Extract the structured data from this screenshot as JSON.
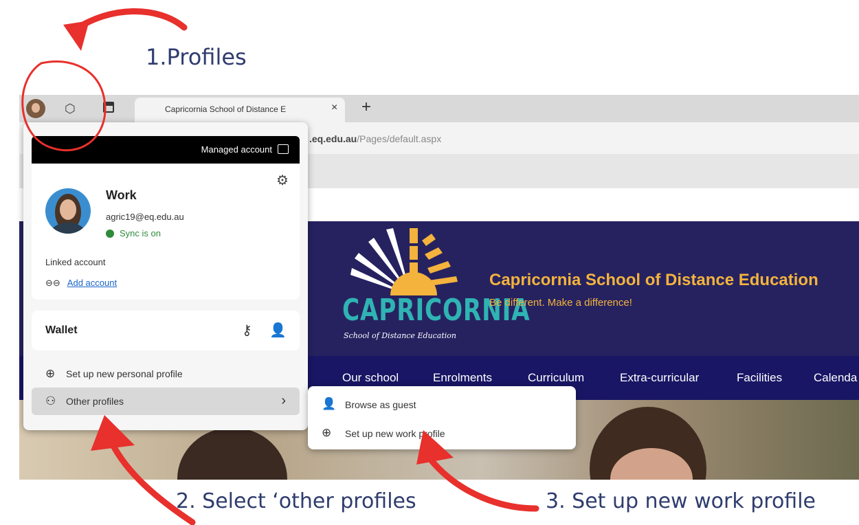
{
  "annotations": {
    "step1": "1.Profiles",
    "step2": "2. Select ‘other profiles",
    "step3": "3. Set up new work profile",
    "arrow_color": "#e8302c"
  },
  "browser": {
    "tab_title": "Capricornia School of Distance E",
    "close_glyph": "×",
    "new_tab_glyph": "+",
    "url_domain": ".eq.edu.au",
    "url_path": "/Pages/default.aspx"
  },
  "profile_flyout": {
    "managed_label": "Managed account",
    "profile_name": "Work",
    "email": "agric19@eq.edu.au",
    "sync_status": "Sync is on",
    "linked_account_label": "Linked account",
    "add_account_label": "Add account",
    "wallet_label": "Wallet",
    "new_personal_profile": "Set up new personal profile",
    "other_profiles": "Other profiles",
    "chevron": "›"
  },
  "submenu": {
    "browse_as_guest": "Browse as guest",
    "new_work_profile": "Set up new work profile"
  },
  "website": {
    "school_name": "Capricornia School of Distance Education",
    "tagline": "Be different. Make a difference!",
    "logo_word": "CAPRICORNIA",
    "logo_sub": "School of Distance Education",
    "nav": [
      "Our school",
      "Enrolments",
      "Curriculum",
      "Extra-curricular",
      "Facilities",
      "Calenda"
    ],
    "colors": {
      "hero_bg": "#262260",
      "nav_bg": "#191665",
      "accent": "#f3b33d",
      "logo_teal": "#2fb3b3"
    }
  }
}
